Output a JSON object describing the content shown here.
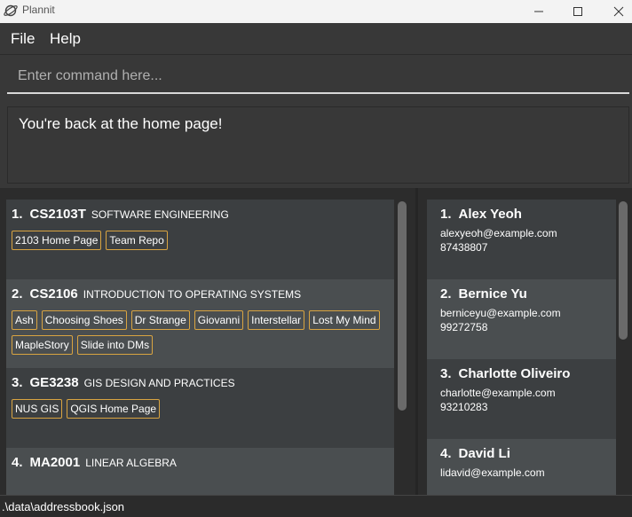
{
  "window": {
    "title": "Plannit",
    "icon": "planet-icon"
  },
  "menu": {
    "file_label": "File",
    "help_label": "Help"
  },
  "command": {
    "placeholder": "Enter command here...",
    "value": ""
  },
  "result": {
    "message": "You're back at the home page!"
  },
  "modules": [
    {
      "index": "1.",
      "code": "CS2103T",
      "title": "SOFTWARE ENGINEERING",
      "tags": [
        "2103 Home Page",
        "Team Repo"
      ]
    },
    {
      "index": "2.",
      "code": "CS2106",
      "title": "INTRODUCTION TO OPERATING SYSTEMS",
      "tags": [
        "Ash",
        "Choosing Shoes",
        "Dr Strange",
        "Giovanni",
        "Interstellar",
        "Lost My Mind",
        "MapleStory",
        "Slide into DMs"
      ]
    },
    {
      "index": "3.",
      "code": "GE3238",
      "title": "GIS DESIGN AND PRACTICES",
      "tags": [
        "NUS GIS",
        "QGIS Home Page"
      ]
    },
    {
      "index": "4.",
      "code": "MA2001",
      "title": "LINEAR ALGEBRA",
      "tags": []
    }
  ],
  "persons": [
    {
      "index": "1.",
      "name": "Alex Yeoh",
      "email": "alexyeoh@example.com",
      "phone": "87438807"
    },
    {
      "index": "2.",
      "name": "Bernice Yu",
      "email": "berniceyu@example.com",
      "phone": "99272758"
    },
    {
      "index": "3.",
      "name": "Charlotte Oliveiro",
      "email": "charlotte@example.com",
      "phone": "93210283"
    },
    {
      "index": "4.",
      "name": "David Li",
      "email": "lidavid@example.com",
      "phone": ""
    }
  ],
  "status": {
    "path": ".\\data\\addressbook.json"
  },
  "colors": {
    "tag_border": "#d9a441",
    "background": "#383838"
  }
}
